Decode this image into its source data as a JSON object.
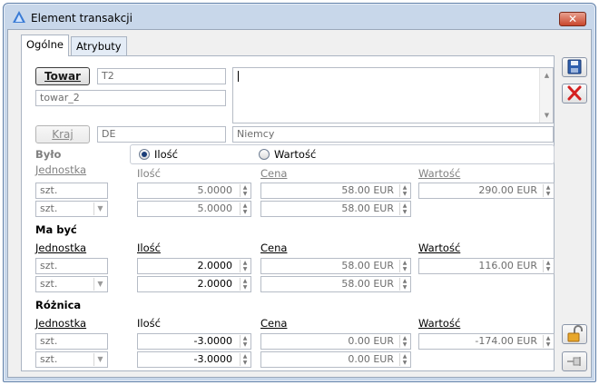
{
  "window": {
    "title": "Element transakcji",
    "close_glyph": "✕"
  },
  "tabs": [
    {
      "label": "Ogólne",
      "active": true
    },
    {
      "label": "Atrybuty",
      "active": false
    }
  ],
  "towar": {
    "button": "Towar",
    "code": "T2",
    "name": "towar_2"
  },
  "kraj": {
    "button": "Kraj",
    "code": "DE",
    "name": "Niemcy"
  },
  "radio": {
    "ilosc": "Ilość",
    "wartosc": "Wartość",
    "selected": "ilosc"
  },
  "headers": {
    "jednostka": "Jednostka",
    "ilosc": "Ilość",
    "cena": "Cena",
    "wartosc": "Wartość"
  },
  "bylo": {
    "title": "Było",
    "unit1": "szt.",
    "unit2": "szt.",
    "qty1": "5.0000",
    "qty2": "5.0000",
    "price1": "58.00 EUR",
    "price2": "58.00 EUR",
    "value": "290.00 EUR"
  },
  "ma_byc": {
    "title": "Ma być",
    "unit1": "szt.",
    "unit2": "szt.",
    "qty1": "2.0000",
    "qty2": "2.0000",
    "price1": "58.00 EUR",
    "price2": "58.00 EUR",
    "value": "116.00 EUR"
  },
  "roznica": {
    "title": "Różnica",
    "unit1": "szt.",
    "unit2": "szt.",
    "qty1": "-3.0000",
    "qty2": "-3.0000",
    "price1": "0.00 EUR",
    "price2": "0.00 EUR",
    "value": "-174.00 EUR"
  },
  "icons": {
    "save": "save-icon",
    "cancel": "cancel-icon",
    "unlock": "unlock-icon",
    "pin": "pin-icon"
  },
  "colors": {
    "accent": "#1b3e78",
    "cancel_red": "#d42020"
  }
}
